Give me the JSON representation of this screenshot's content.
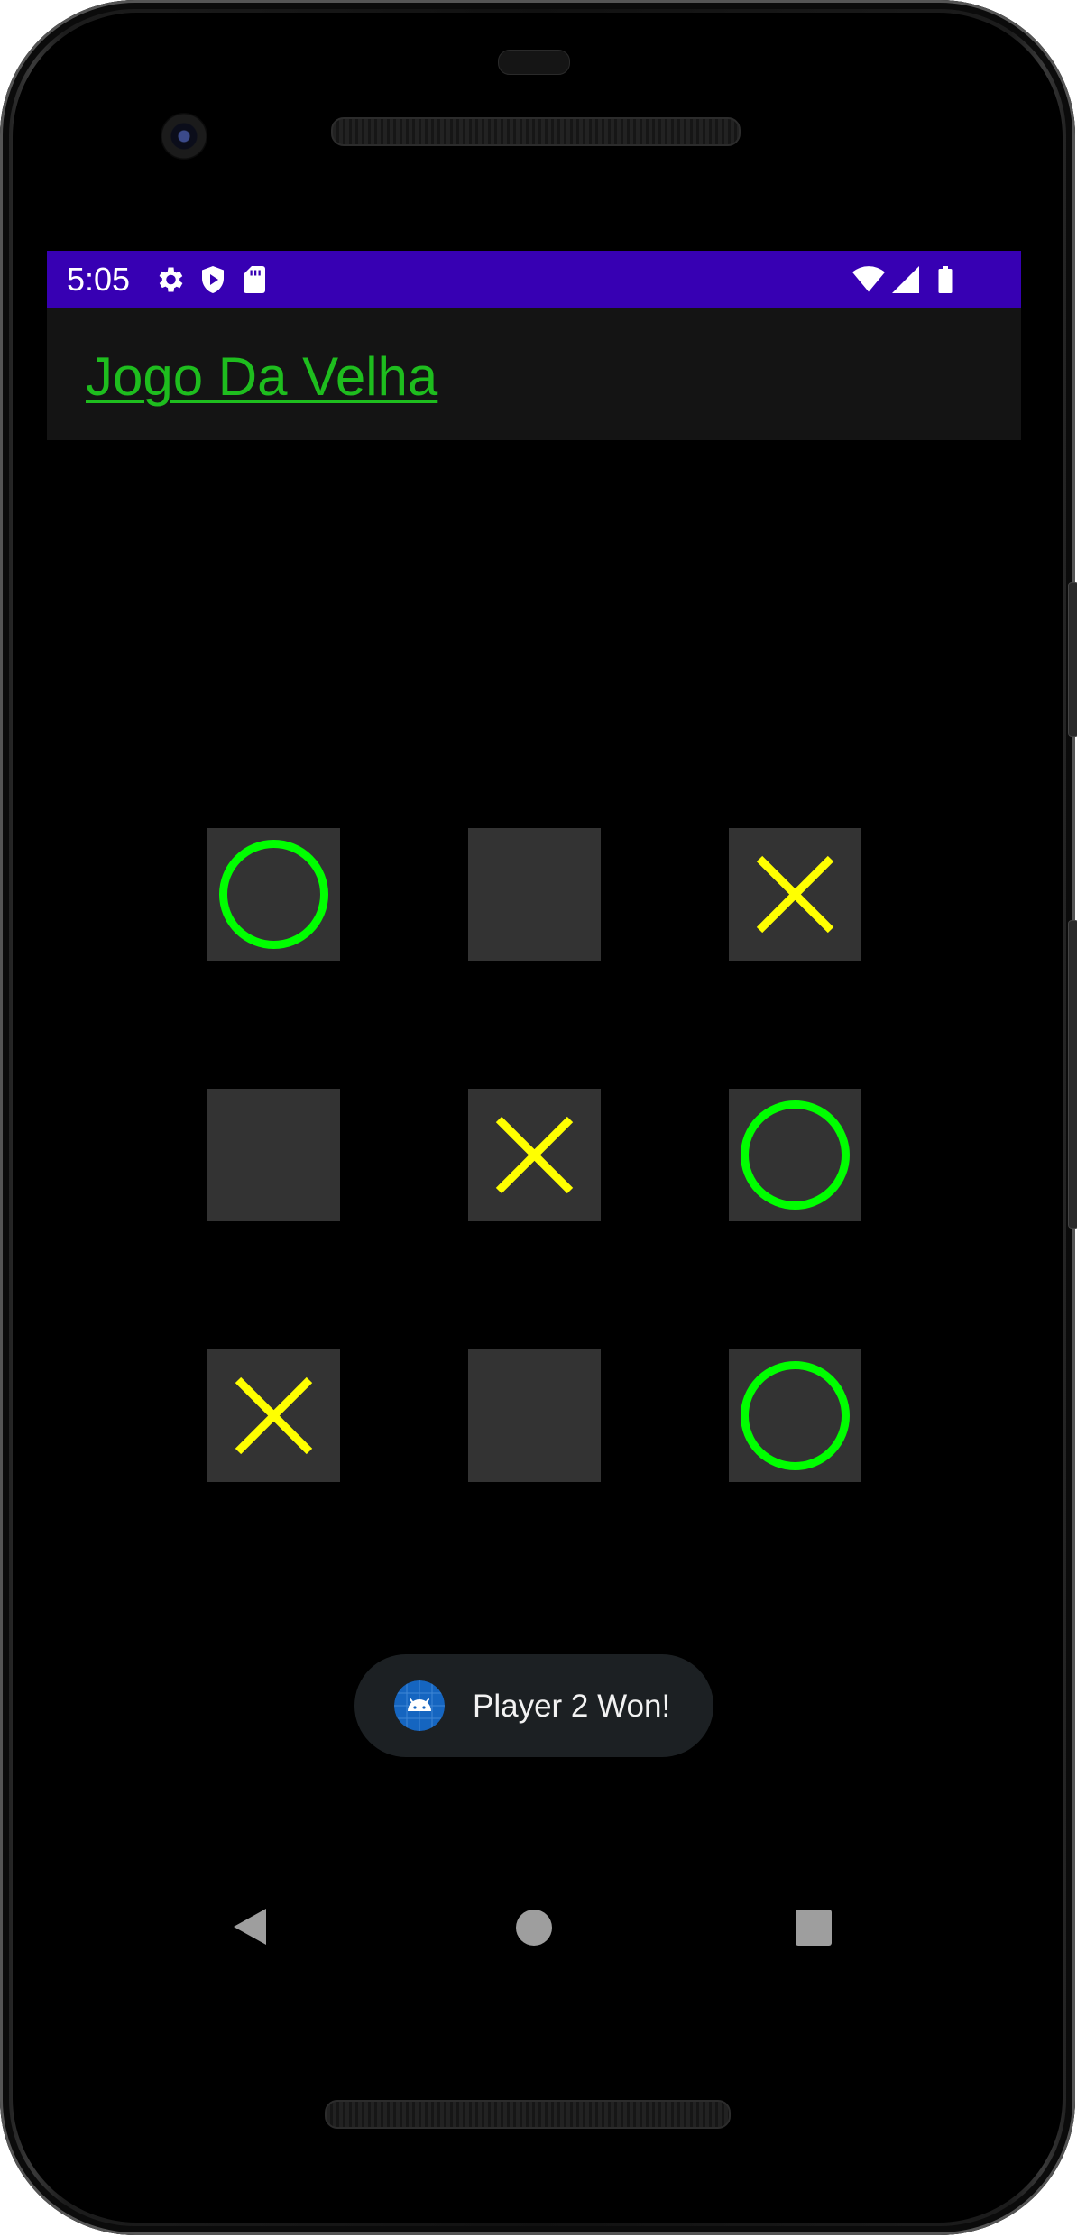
{
  "status_bar": {
    "time": "5:05",
    "left_icons": [
      "gear-icon",
      "shield-play-icon",
      "sd-card-icon"
    ],
    "right_icons": [
      "wifi-icon",
      "cell-signal-icon",
      "battery-icon"
    ],
    "background": "#3700b3"
  },
  "app_bar": {
    "title": "Jogo Da Velha",
    "title_color": "#1ebd1e"
  },
  "board": {
    "cells": [
      {
        "row": 1,
        "col": 1,
        "mark": "O"
      },
      {
        "row": 1,
        "col": 2,
        "mark": ""
      },
      {
        "row": 1,
        "col": 3,
        "mark": "X"
      },
      {
        "row": 2,
        "col": 1,
        "mark": ""
      },
      {
        "row": 2,
        "col": 2,
        "mark": "X"
      },
      {
        "row": 2,
        "col": 3,
        "mark": "O"
      },
      {
        "row": 3,
        "col": 1,
        "mark": "X"
      },
      {
        "row": 3,
        "col": 2,
        "mark": ""
      },
      {
        "row": 3,
        "col": 3,
        "mark": "O"
      }
    ],
    "colors": {
      "o": "#00ff00",
      "x": "#ffff00",
      "cell": "#333333"
    }
  },
  "toast": {
    "icon": "android-icon",
    "message": "Player 2 Won!"
  },
  "nav_bar": {
    "buttons": [
      "back-icon",
      "home-icon",
      "recents-icon"
    ]
  }
}
